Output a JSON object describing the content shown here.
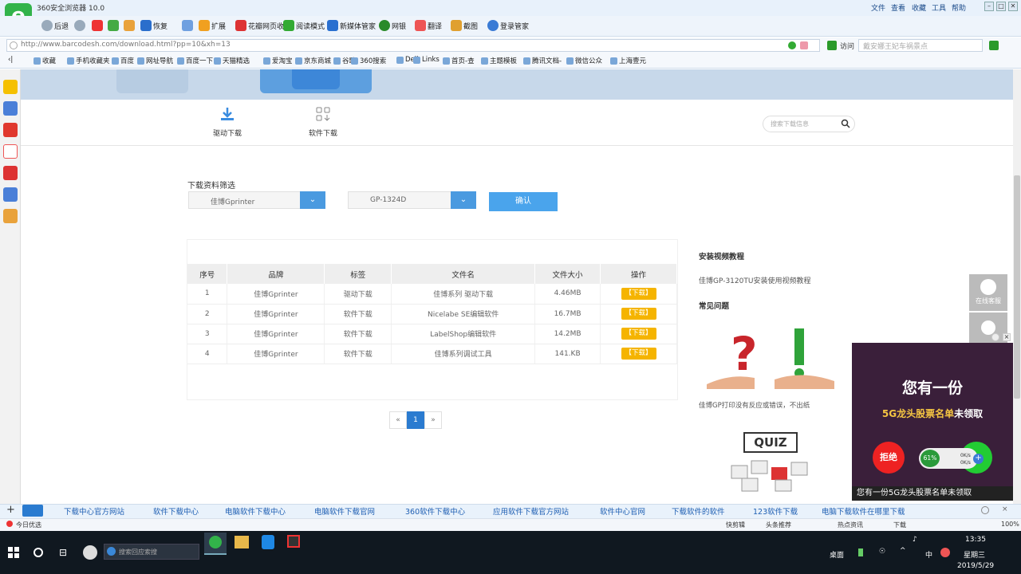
{
  "browser": {
    "logo_glyph": "e",
    "title": "360安全浏览器 10.0",
    "menu": [
      "文件",
      "查看",
      "收藏",
      "工具",
      "帮助"
    ],
    "toolbar": {
      "back": "后退",
      "restore": "恢复",
      "extend": "扩展",
      "flower": "花瓣网页收",
      "reader": "阅读模式",
      "media": "新媒体管家",
      "bank": "网银",
      "translate": "翻译",
      "screenshot": "截图",
      "login": "登录管家"
    },
    "url": "http://www.barcodesh.com/download.html?pp=10&xh=13",
    "visit_label": "访问",
    "search_placeholder": "戴安娜王妃车祸景点",
    "bookmarks": [
      "收藏",
      "手机收藏夹",
      "百度",
      "网址导航",
      "百度一下",
      "天猫精选",
      "爱淘宝",
      "京东商城",
      "谷歌",
      "360搜索",
      "Dell",
      "Links",
      "首页-查",
      "主题模板",
      "腾讯文档-",
      "微信公众",
      "上海壹元"
    ]
  },
  "page": {
    "tabs": {
      "driver": "驱动下载",
      "software": "软件下载"
    },
    "search_placeholder": "搜索下载信息",
    "filter_label": "下载资料筛选",
    "brand_select": "佳博Gprinter",
    "model_select": "GP-1324D",
    "confirm": "确认",
    "table": {
      "headers": [
        "序号",
        "品牌",
        "标签",
        "文件名",
        "文件大小",
        "操作"
      ],
      "rows": [
        [
          "1",
          "佳博Gprinter",
          "驱动下载",
          "佳博系列 驱动下载",
          "4.46MB",
          "【下载】"
        ],
        [
          "2",
          "佳博Gprinter",
          "软件下载",
          "Nicelabe SE编辑软件",
          "16.7MB",
          "【下载】"
        ],
        [
          "3",
          "佳博Gprinter",
          "软件下载",
          "LabelShop编辑软件",
          "14.2MB",
          "【下载】"
        ],
        [
          "4",
          "佳博Gprinter",
          "软件下载",
          "佳博系列调试工具",
          "141.KB",
          "【下载】"
        ]
      ]
    },
    "pagination": {
      "prev": "«",
      "current": "1",
      "next": "»"
    },
    "side": {
      "video_heading": "安装视频教程",
      "video_link": "佳博GP-3120TU安装使用视频教程",
      "faq_heading": "常见问题",
      "faq_item": "佳博GP打印没有反应或错误，不出纸",
      "quiz_label": "QUIZ"
    },
    "online_service": "在线客服"
  },
  "ad": {
    "title": "您有一份",
    "subtitle_highlight": "5G龙头股票名单",
    "subtitle_rest": "未领取",
    "decline": "拒绝",
    "percent": "61%",
    "speed_up": "0K/s",
    "speed_down": "0K/s",
    "footer": "您有一份5G龙头股票名单未领取"
  },
  "linkbar": [
    "下载中心官方网站",
    "软件下载中心",
    "电脑软件下载中心",
    "电脑软件下载官网",
    "360软件下载中心",
    "应用软件下载官方网站",
    "软件中心官网",
    "下载软件的软件",
    "123软件下载",
    "电脑下载软件在哪里下载"
  ],
  "status": {
    "left": "今日优选",
    "items": [
      "快剪辑",
      "头条推荐",
      "热点资讯",
      "下载"
    ],
    "zoom": "100%"
  },
  "taskbar": {
    "search_placeholder": "搜索回应索搜",
    "desktop": "桌面",
    "ime": "中",
    "time": "13:35",
    "weekday": "星期三",
    "date": "2019/5/29"
  }
}
